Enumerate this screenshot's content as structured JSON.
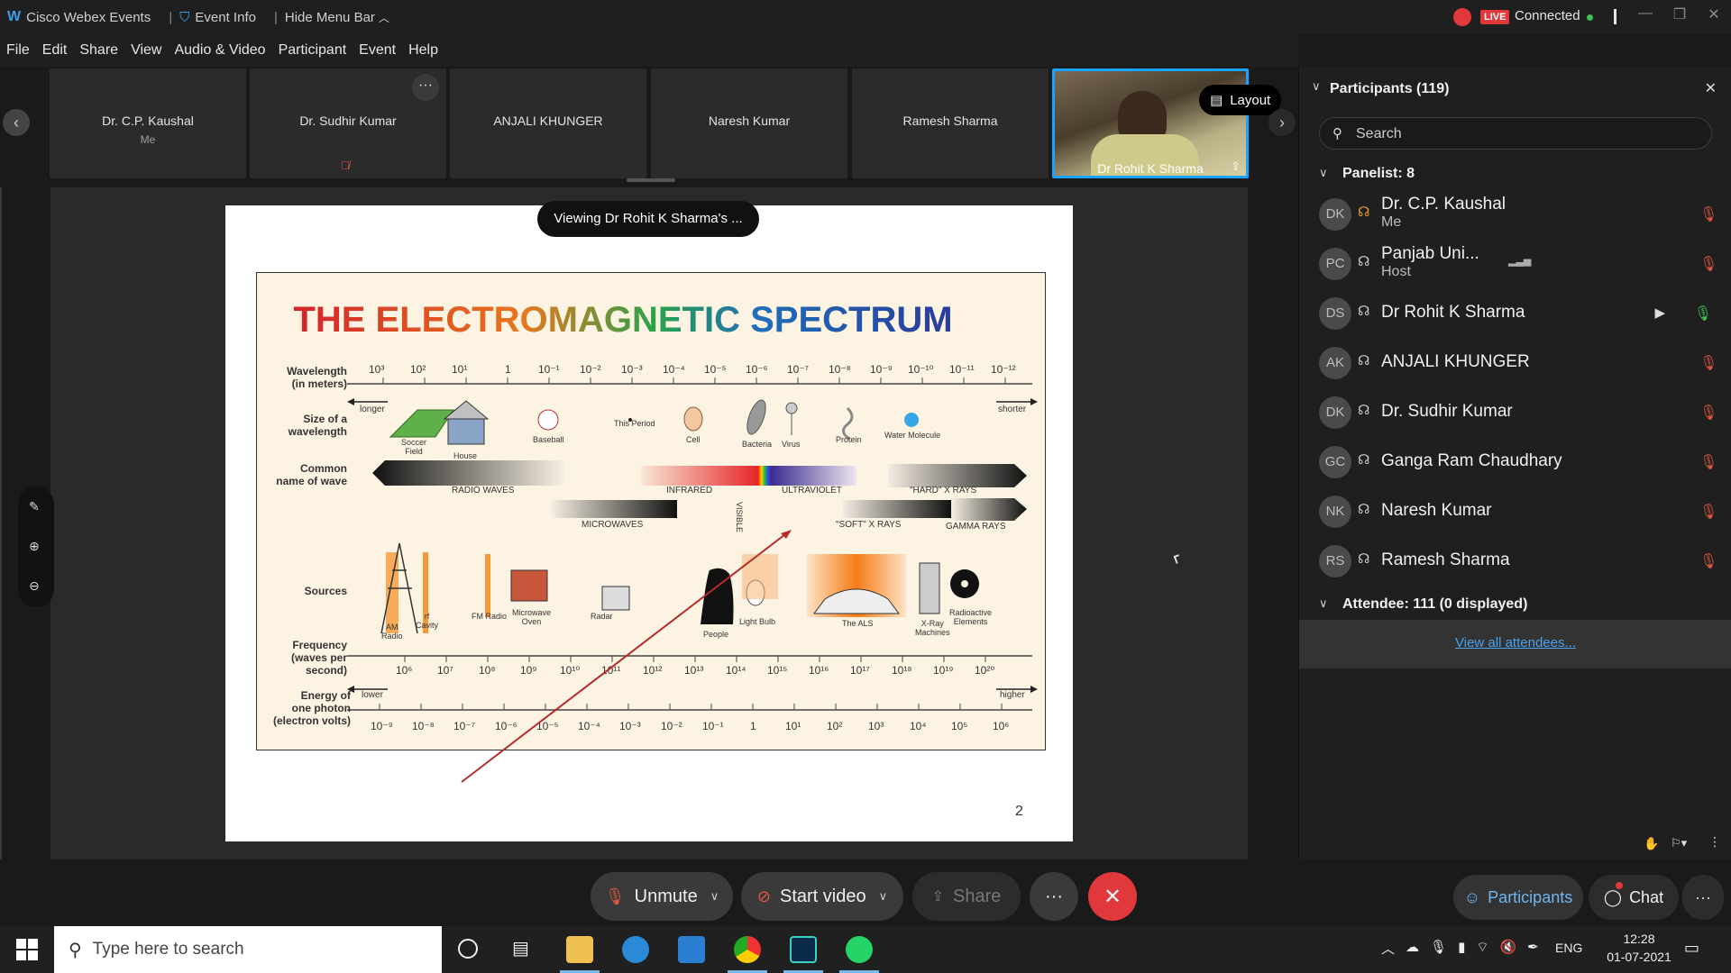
{
  "titlebar": {
    "app_name": "Cisco Webex Events",
    "event_info": "Event Info",
    "hide_menu_bar": "Hide Menu Bar",
    "live_badge": "LIVE",
    "status": "Connected"
  },
  "menubar": {
    "items": [
      "File",
      "Edit",
      "Share",
      "View",
      "Audio & Video",
      "Participant",
      "Event",
      "Help"
    ]
  },
  "filmstrip": {
    "tiles": [
      {
        "name": "Dr. C.P. Kaushal",
        "sub": "Me"
      },
      {
        "name": "Dr. Sudhir Kumar",
        "sub": ""
      },
      {
        "name": "ANJALI KHUNGER",
        "sub": ""
      },
      {
        "name": "Naresh Kumar",
        "sub": ""
      },
      {
        "name": "Ramesh Sharma",
        "sub": ""
      },
      {
        "name": "Dr Rohit K Sharma",
        "sub": ""
      }
    ],
    "more_label": "···",
    "layout_label": "Layout"
  },
  "stage": {
    "viewing_banner": "Viewing Dr Rohit K Sharma's ...",
    "page_number": "2"
  },
  "spectrum": {
    "title": "THE ELECTROMAGNETIC SPECTRUM",
    "row_labels": {
      "wavelength": "Wavelength\n(in meters)",
      "size": "Size of a\nwavelength",
      "common": "Common\nname of wave",
      "sources": "Sources",
      "frequency": "Frequency\n(waves per\nsecond)",
      "energy": "Energy of\none photon\n(electron volts)"
    },
    "longer": "longer",
    "shorter": "shorter",
    "lower": "lower",
    "higher": "higher",
    "wavelength_ticks": [
      "10³",
      "10²",
      "10¹",
      "1",
      "10⁻¹",
      "10⁻²",
      "10⁻³",
      "10⁻⁴",
      "10⁻⁵",
      "10⁻⁶",
      "10⁻⁷",
      "10⁻⁸",
      "10⁻⁹",
      "10⁻¹⁰",
      "10⁻¹¹",
      "10⁻¹²"
    ],
    "size_items": [
      "Soccer\nField",
      "House",
      "Baseball",
      "This Period",
      "Cell",
      "Bacteria",
      "Virus",
      "Protein",
      "Water Molecule"
    ],
    "wave_names": {
      "radio": "RADIO WAVES",
      "infrared": "INFRARED",
      "visible": "VISIBLE",
      "ultraviolet": "ULTRAVIOLET",
      "hard_xrays": "\"HARD\" X RAYS",
      "microwaves": "MICROWAVES",
      "soft_xrays": "\"SOFT\" X RAYS",
      "gamma": "GAMMA RAYS"
    },
    "sources": [
      "AM\nRadio",
      "rf\nCavity",
      "FM Radio",
      "Microwave\nOven",
      "Radar",
      "People",
      "Light Bulb",
      "The ALS",
      "X-Ray\nMachines",
      "Radioactive\nElements"
    ],
    "frequency_ticks": [
      "10⁶",
      "10⁷",
      "10⁸",
      "10⁹",
      "10¹⁰",
      "10¹¹",
      "10¹²",
      "10¹³",
      "10¹⁴",
      "10¹⁵",
      "10¹⁶",
      "10¹⁷",
      "10¹⁸",
      "10¹⁹",
      "10²⁰"
    ],
    "energy_ticks": [
      "10⁻⁹",
      "10⁻⁸",
      "10⁻⁷",
      "10⁻⁶",
      "10⁻⁵",
      "10⁻⁴",
      "10⁻³",
      "10⁻²",
      "10⁻¹",
      "1",
      "10¹",
      "10²",
      "10³",
      "10⁴",
      "10⁵",
      "10⁶"
    ]
  },
  "panel": {
    "title": "Participants (119)",
    "search_placeholder": "Search",
    "panelist_header": "Panelist: 8",
    "attendee_header": "Attendee: 111 (0 displayed)",
    "view_all": "View all attendees...",
    "participants": [
      {
        "initials": "DK",
        "name": "Dr. C.P. Kaushal",
        "sub": "Me"
      },
      {
        "initials": "PC",
        "name": "Panjab Uni...",
        "sub": "Host"
      },
      {
        "initials": "DS",
        "name": "Dr Rohit K Sharma",
        "sub": ""
      },
      {
        "initials": "AK",
        "name": "ANJALI KHUNGER",
        "sub": ""
      },
      {
        "initials": "DK",
        "name": "Dr. Sudhir Kumar",
        "sub": ""
      },
      {
        "initials": "GC",
        "name": "Ganga Ram Chaudhary",
        "sub": ""
      },
      {
        "initials": "NK",
        "name": "Naresh Kumar",
        "sub": ""
      },
      {
        "initials": "RS",
        "name": "Ramesh Sharma",
        "sub": ""
      }
    ]
  },
  "controls": {
    "unmute": "Unmute",
    "start_video": "Start video",
    "share": "Share",
    "more": "···",
    "participants": "Participants",
    "chat": "Chat"
  },
  "taskbar": {
    "search_placeholder": "Type here to search",
    "lang": "ENG",
    "time": "12:28",
    "date": "01-07-2021"
  }
}
